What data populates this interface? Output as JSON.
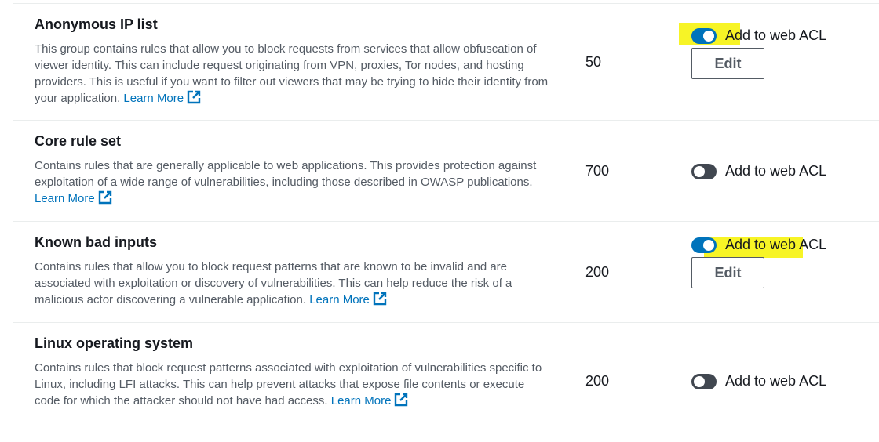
{
  "rules": [
    {
      "title": "Anonymous IP list",
      "description": "This group contains rules that allow you to block requests from services that allow obfuscation of viewer identity. This can include request originating from VPN, proxies, Tor nodes, and hosting providers. This is useful if you want to filter out viewers that may be trying to hide their identity from your application.",
      "learn_more": "Learn More",
      "capacity": "50",
      "toggle_label": "Add to web ACL",
      "enabled": true,
      "edit_label": "Edit"
    },
    {
      "title": "Core rule set",
      "description": "Contains rules that are generally applicable to web applications. This provides protection against exploitation of a wide range of vulnerabilities, including those described in OWASP publications.",
      "learn_more": "Learn More",
      "capacity": "700",
      "toggle_label": "Add to web ACL",
      "enabled": false
    },
    {
      "title": "Known bad inputs",
      "description": "Contains rules that allow you to block request patterns that are known to be invalid and are associated with exploitation or discovery of vulnerabilities. This can help reduce the risk of a malicious actor discovering a vulnerable application.",
      "learn_more": "Learn More",
      "capacity": "200",
      "toggle_label": "Add to web ACL",
      "enabled": true,
      "edit_label": "Edit"
    },
    {
      "title": "Linux operating system",
      "description": "Contains rules that block request patterns associated with exploitation of vulnerabilities specific to Linux, including LFI attacks. This can help prevent attacks that expose file contents or execute code for which the attacker should not have had access.",
      "learn_more": "Learn More",
      "capacity": "200",
      "toggle_label": "Add to web ACL",
      "enabled": false
    }
  ],
  "colors": {
    "link": "#0073bb",
    "toggle_on": "#0073bb",
    "toggle_off": "#414750",
    "highlight": "#f6f200"
  },
  "icons": {
    "learn_more": "external-link-icon"
  }
}
